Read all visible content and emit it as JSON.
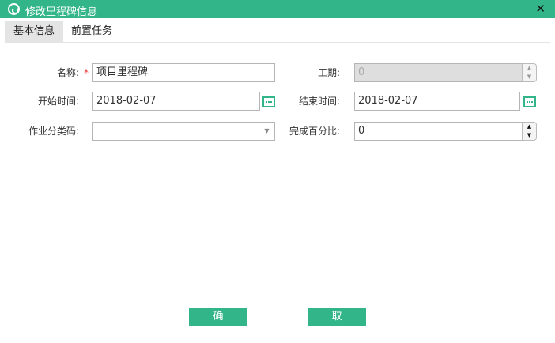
{
  "window": {
    "title": "修改里程碑信息",
    "close": "✕"
  },
  "tabs": [
    {
      "label": "基本信息"
    },
    {
      "label": "前置任务"
    }
  ],
  "form": {
    "name": {
      "label": "名称:",
      "required": "*",
      "value": "项目里程碑"
    },
    "duration": {
      "label": "工期:",
      "value": "0"
    },
    "start": {
      "label": "开始时间:",
      "value": "2018-02-07"
    },
    "end": {
      "label": "结束时间:",
      "value": "2018-02-07"
    },
    "category": {
      "label": "作业分类码:",
      "value": ""
    },
    "percent": {
      "label": "完成百分比:",
      "value": "0"
    }
  },
  "buttons": {
    "ok": "确定",
    "cancel": "取消"
  },
  "colors": {
    "accent": "#33b58a"
  }
}
